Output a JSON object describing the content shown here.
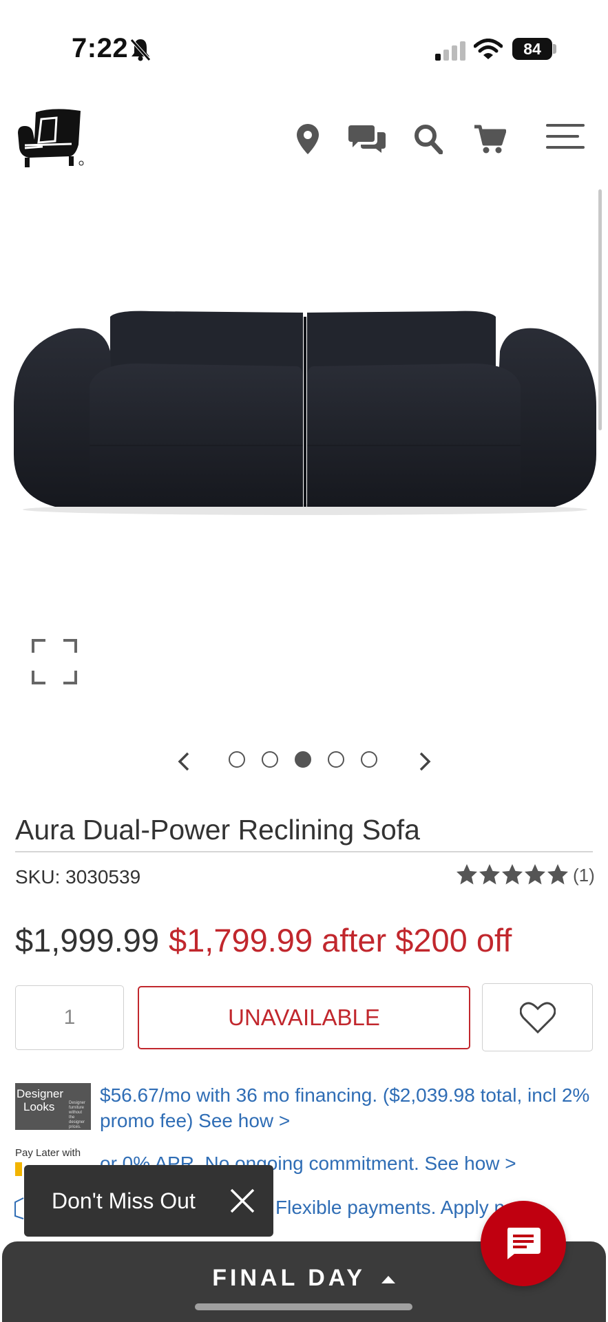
{
  "status_bar": {
    "time": "7:22",
    "battery": "84"
  },
  "product": {
    "title": "Aura Dual-Power Reclining Sofa",
    "sku": "SKU: 3030539",
    "rating": 5,
    "rating_count": "(1)",
    "price_original": "$1,999.99",
    "price_sale": "$1,799.99 after $200 off",
    "quantity": "1",
    "availability_button": "UNAVAILABLE"
  },
  "carousel": {
    "total": 5,
    "active_index": 2
  },
  "financing": {
    "designer_looks_line1": "Designer",
    "designer_looks_line2": "Looks",
    "designer_looks_small": "Designer furniture without the designer prices.",
    "text": "$56.67/mo with 36 mo financing. ($2,039.98 total, incl 2% promo fee) See how >",
    "pay_later_label": "Pay Later with",
    "pay_later_text": "or 0% APR. No ongoing commitment. See how >",
    "flexible_text": "Flexible payments. Apply now >"
  },
  "toast": {
    "text": "Don't Miss Out"
  },
  "promo_bar": {
    "label": "FINAL DAY"
  },
  "colors": {
    "accent_red": "#c1272d",
    "link_blue": "#2f6db5",
    "dark_bar": "#3b3b3b"
  }
}
